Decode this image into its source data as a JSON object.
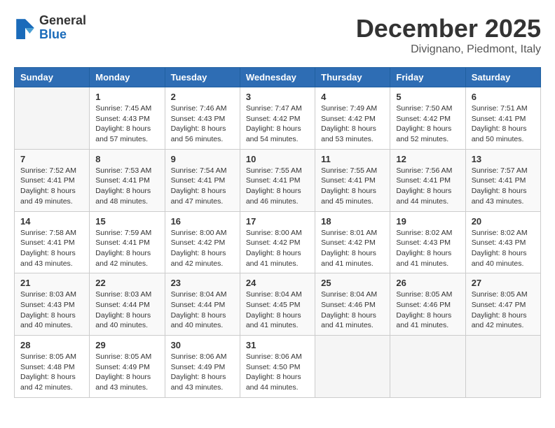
{
  "logo": {
    "line1": "General",
    "line2": "Blue"
  },
  "title": "December 2025",
  "location": "Divignano, Piedmont, Italy",
  "weekdays": [
    "Sunday",
    "Monday",
    "Tuesday",
    "Wednesday",
    "Thursday",
    "Friday",
    "Saturday"
  ],
  "weeks": [
    [
      {
        "day": "",
        "sunrise": "",
        "sunset": "",
        "daylight": ""
      },
      {
        "day": "1",
        "sunrise": "Sunrise: 7:45 AM",
        "sunset": "Sunset: 4:43 PM",
        "daylight": "Daylight: 8 hours and 57 minutes."
      },
      {
        "day": "2",
        "sunrise": "Sunrise: 7:46 AM",
        "sunset": "Sunset: 4:43 PM",
        "daylight": "Daylight: 8 hours and 56 minutes."
      },
      {
        "day": "3",
        "sunrise": "Sunrise: 7:47 AM",
        "sunset": "Sunset: 4:42 PM",
        "daylight": "Daylight: 8 hours and 54 minutes."
      },
      {
        "day": "4",
        "sunrise": "Sunrise: 7:49 AM",
        "sunset": "Sunset: 4:42 PM",
        "daylight": "Daylight: 8 hours and 53 minutes."
      },
      {
        "day": "5",
        "sunrise": "Sunrise: 7:50 AM",
        "sunset": "Sunset: 4:42 PM",
        "daylight": "Daylight: 8 hours and 52 minutes."
      },
      {
        "day": "6",
        "sunrise": "Sunrise: 7:51 AM",
        "sunset": "Sunset: 4:41 PM",
        "daylight": "Daylight: 8 hours and 50 minutes."
      }
    ],
    [
      {
        "day": "7",
        "sunrise": "Sunrise: 7:52 AM",
        "sunset": "Sunset: 4:41 PM",
        "daylight": "Daylight: 8 hours and 49 minutes."
      },
      {
        "day": "8",
        "sunrise": "Sunrise: 7:53 AM",
        "sunset": "Sunset: 4:41 PM",
        "daylight": "Daylight: 8 hours and 48 minutes."
      },
      {
        "day": "9",
        "sunrise": "Sunrise: 7:54 AM",
        "sunset": "Sunset: 4:41 PM",
        "daylight": "Daylight: 8 hours and 47 minutes."
      },
      {
        "day": "10",
        "sunrise": "Sunrise: 7:55 AM",
        "sunset": "Sunset: 4:41 PM",
        "daylight": "Daylight: 8 hours and 46 minutes."
      },
      {
        "day": "11",
        "sunrise": "Sunrise: 7:55 AM",
        "sunset": "Sunset: 4:41 PM",
        "daylight": "Daylight: 8 hours and 45 minutes."
      },
      {
        "day": "12",
        "sunrise": "Sunrise: 7:56 AM",
        "sunset": "Sunset: 4:41 PM",
        "daylight": "Daylight: 8 hours and 44 minutes."
      },
      {
        "day": "13",
        "sunrise": "Sunrise: 7:57 AM",
        "sunset": "Sunset: 4:41 PM",
        "daylight": "Daylight: 8 hours and 43 minutes."
      }
    ],
    [
      {
        "day": "14",
        "sunrise": "Sunrise: 7:58 AM",
        "sunset": "Sunset: 4:41 PM",
        "daylight": "Daylight: 8 hours and 43 minutes."
      },
      {
        "day": "15",
        "sunrise": "Sunrise: 7:59 AM",
        "sunset": "Sunset: 4:41 PM",
        "daylight": "Daylight: 8 hours and 42 minutes."
      },
      {
        "day": "16",
        "sunrise": "Sunrise: 8:00 AM",
        "sunset": "Sunset: 4:42 PM",
        "daylight": "Daylight: 8 hours and 42 minutes."
      },
      {
        "day": "17",
        "sunrise": "Sunrise: 8:00 AM",
        "sunset": "Sunset: 4:42 PM",
        "daylight": "Daylight: 8 hours and 41 minutes."
      },
      {
        "day": "18",
        "sunrise": "Sunrise: 8:01 AM",
        "sunset": "Sunset: 4:42 PM",
        "daylight": "Daylight: 8 hours and 41 minutes."
      },
      {
        "day": "19",
        "sunrise": "Sunrise: 8:02 AM",
        "sunset": "Sunset: 4:43 PM",
        "daylight": "Daylight: 8 hours and 41 minutes."
      },
      {
        "day": "20",
        "sunrise": "Sunrise: 8:02 AM",
        "sunset": "Sunset: 4:43 PM",
        "daylight": "Daylight: 8 hours and 40 minutes."
      }
    ],
    [
      {
        "day": "21",
        "sunrise": "Sunrise: 8:03 AM",
        "sunset": "Sunset: 4:43 PM",
        "daylight": "Daylight: 8 hours and 40 minutes."
      },
      {
        "day": "22",
        "sunrise": "Sunrise: 8:03 AM",
        "sunset": "Sunset: 4:44 PM",
        "daylight": "Daylight: 8 hours and 40 minutes."
      },
      {
        "day": "23",
        "sunrise": "Sunrise: 8:04 AM",
        "sunset": "Sunset: 4:44 PM",
        "daylight": "Daylight: 8 hours and 40 minutes."
      },
      {
        "day": "24",
        "sunrise": "Sunrise: 8:04 AM",
        "sunset": "Sunset: 4:45 PM",
        "daylight": "Daylight: 8 hours and 41 minutes."
      },
      {
        "day": "25",
        "sunrise": "Sunrise: 8:04 AM",
        "sunset": "Sunset: 4:46 PM",
        "daylight": "Daylight: 8 hours and 41 minutes."
      },
      {
        "day": "26",
        "sunrise": "Sunrise: 8:05 AM",
        "sunset": "Sunset: 4:46 PM",
        "daylight": "Daylight: 8 hours and 41 minutes."
      },
      {
        "day": "27",
        "sunrise": "Sunrise: 8:05 AM",
        "sunset": "Sunset: 4:47 PM",
        "daylight": "Daylight: 8 hours and 42 minutes."
      }
    ],
    [
      {
        "day": "28",
        "sunrise": "Sunrise: 8:05 AM",
        "sunset": "Sunset: 4:48 PM",
        "daylight": "Daylight: 8 hours and 42 minutes."
      },
      {
        "day": "29",
        "sunrise": "Sunrise: 8:05 AM",
        "sunset": "Sunset: 4:49 PM",
        "daylight": "Daylight: 8 hours and 43 minutes."
      },
      {
        "day": "30",
        "sunrise": "Sunrise: 8:06 AM",
        "sunset": "Sunset: 4:49 PM",
        "daylight": "Daylight: 8 hours and 43 minutes."
      },
      {
        "day": "31",
        "sunrise": "Sunrise: 8:06 AM",
        "sunset": "Sunset: 4:50 PM",
        "daylight": "Daylight: 8 hours and 44 minutes."
      },
      {
        "day": "",
        "sunrise": "",
        "sunset": "",
        "daylight": ""
      },
      {
        "day": "",
        "sunrise": "",
        "sunset": "",
        "daylight": ""
      },
      {
        "day": "",
        "sunrise": "",
        "sunset": "",
        "daylight": ""
      }
    ]
  ]
}
